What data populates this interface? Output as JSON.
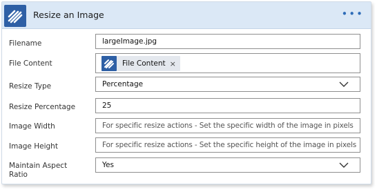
{
  "header": {
    "title": "Resize an Image",
    "more_label": "•••"
  },
  "fields": {
    "filename": {
      "label": "Filename",
      "value": "largeImage.jpg"
    },
    "file_content": {
      "label": "File Content",
      "token": "File Content",
      "remove": "×"
    },
    "resize_type": {
      "label": "Resize Type",
      "value": "Percentage"
    },
    "resize_percentage": {
      "label": "Resize Percentage",
      "value": "25"
    },
    "image_width": {
      "label": "Image Width",
      "placeholder": "For specific resize actions - Set the specific width of the image in pixels"
    },
    "image_height": {
      "label": "Image Height",
      "placeholder": "For specific resize actions - Set the specific height of the image in pixels"
    },
    "maintain_aspect": {
      "label_line1": "Maintain Aspect",
      "label_line2": "Ratio",
      "value": "Yes"
    }
  },
  "colors": {
    "header_bg": "#dbe8f6",
    "logo_bg": "#2e5fa5",
    "accent": "#2e6cb8",
    "border": "#8e8e8e"
  },
  "icons": {
    "logo": "diagonal-stripes-icon",
    "more": "more-options-icon",
    "dropdown": "chevron-down-icon",
    "remove": "close-icon"
  }
}
